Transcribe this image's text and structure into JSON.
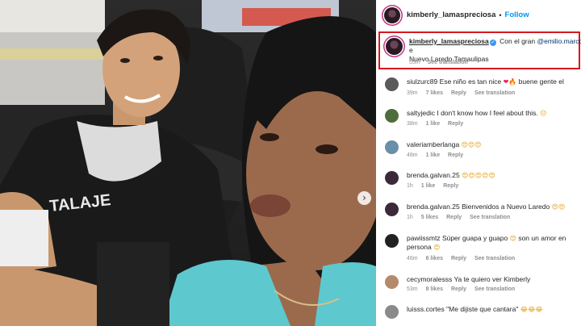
{
  "header": {
    "username": "kimberly_lamaspreciosa",
    "separator": "•",
    "follow_label": "Follow"
  },
  "caption": {
    "username": "kimberly_lamaspreciosa",
    "verified_glyph": "✓",
    "text_start": "Con el gran",
    "mention": "@emilio.marcos",
    "text_rest": "e",
    "location": "Nuevo Laredo Tamaulipas",
    "time": "55m",
    "see_translation": "See translation"
  },
  "comments": [
    {
      "username": "siulzurc89",
      "text": "Ese niño es tan nice",
      "emoji": "❤🔥",
      "text_after": "buene gente el",
      "time": "39m",
      "likes": "7 likes",
      "reply": "Reply",
      "see_translation": "See translation"
    },
    {
      "username": "saltyjedic",
      "text": "I don't know how I feel about this.",
      "emoji": "☹",
      "text_after": "",
      "time": "38m",
      "likes": "1 like",
      "reply": "Reply",
      "see_translation": ""
    },
    {
      "username": "valeriamberlanga",
      "text": "",
      "emoji": "😍😍😍",
      "text_after": "",
      "time": "48m",
      "likes": "1 like",
      "reply": "Reply",
      "see_translation": ""
    },
    {
      "username": "brenda.galvan.25",
      "text": "",
      "emoji": "😍😍😍😍😍",
      "text_after": "",
      "time": "1h",
      "likes": "1 like",
      "reply": "Reply",
      "see_translation": ""
    },
    {
      "username": "brenda.galvan.25",
      "text": "Bienvenidos a Nuevo Laredo",
      "emoji": "😍😍",
      "text_after": "",
      "time": "1h",
      "likes": "5 likes",
      "reply": "Reply",
      "see_translation": "See translation"
    },
    {
      "username": "pawiissmtz",
      "text": "Súper guapa y guapo",
      "emoji": "😍",
      "text_after": "son un amor en persona",
      "emoji2": "😍",
      "time": "46m",
      "likes": "6 likes",
      "reply": "Reply",
      "see_translation": "See translation"
    },
    {
      "username": "cecymoralesss",
      "text": "Ya te quiero ver Kimberly",
      "emoji": "",
      "text_after": "",
      "time": "53m",
      "likes": "8 likes",
      "reply": "Reply",
      "see_translation": "See translation"
    },
    {
      "username": "luisss.cortes",
      "text": "\"Me dijiste que cantara\"",
      "emoji": "😂😂😂",
      "text_after": "",
      "time": "",
      "likes": "",
      "reply": "",
      "see_translation": ""
    }
  ],
  "photo": {
    "next_glyph": "›",
    "shirt_text": "TALAJE"
  },
  "colors": {
    "follow": "#0095f6",
    "highlight_box": "#d6171f",
    "mention": "#00376b",
    "meta": "#8e8e8e"
  }
}
